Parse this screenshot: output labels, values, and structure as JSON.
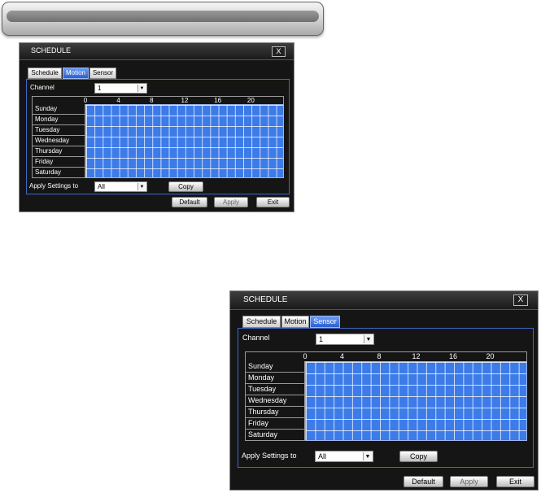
{
  "schedule_motion": {
    "title": "SCHEDULE",
    "close": "X",
    "tabs": [
      "Schedule",
      "Motion",
      "Sensor"
    ],
    "active_tab": "Motion",
    "channel_label": "Channel",
    "channel_value": "1",
    "hours": [
      "0",
      "4",
      "8",
      "12",
      "16",
      "20"
    ],
    "days": [
      "Sunday",
      "Monday",
      "Tuesday",
      "Wednesday",
      "Thursday",
      "Friday",
      "Saturday"
    ],
    "apply_settings_label": "Apply Settings to",
    "apply_settings_value": "All",
    "copy": "Copy",
    "default": "Default",
    "apply": "Apply",
    "exit": "Exit"
  },
  "schedule_sensor": {
    "title": "SCHEDULE",
    "close": "X",
    "tabs": [
      "Schedule",
      "Motion",
      "Sensor"
    ],
    "active_tab": "Sensor",
    "channel_label": "Channel",
    "channel_value": "1",
    "hours": [
      "0",
      "4",
      "8",
      "12",
      "16",
      "20"
    ],
    "days": [
      "Sunday",
      "Monday",
      "Tuesday",
      "Wednesday",
      "Thursday",
      "Friday",
      "Saturday"
    ],
    "apply_settings_label": "Apply Settings to",
    "apply_settings_value": "All",
    "copy": "Copy",
    "default": "Default",
    "apply": "Apply",
    "exit": "Exit"
  },
  "colors": {
    "grid_fill": "#3c7be8",
    "active_tab": "#2c5fd0",
    "window_bg": "#151515"
  }
}
